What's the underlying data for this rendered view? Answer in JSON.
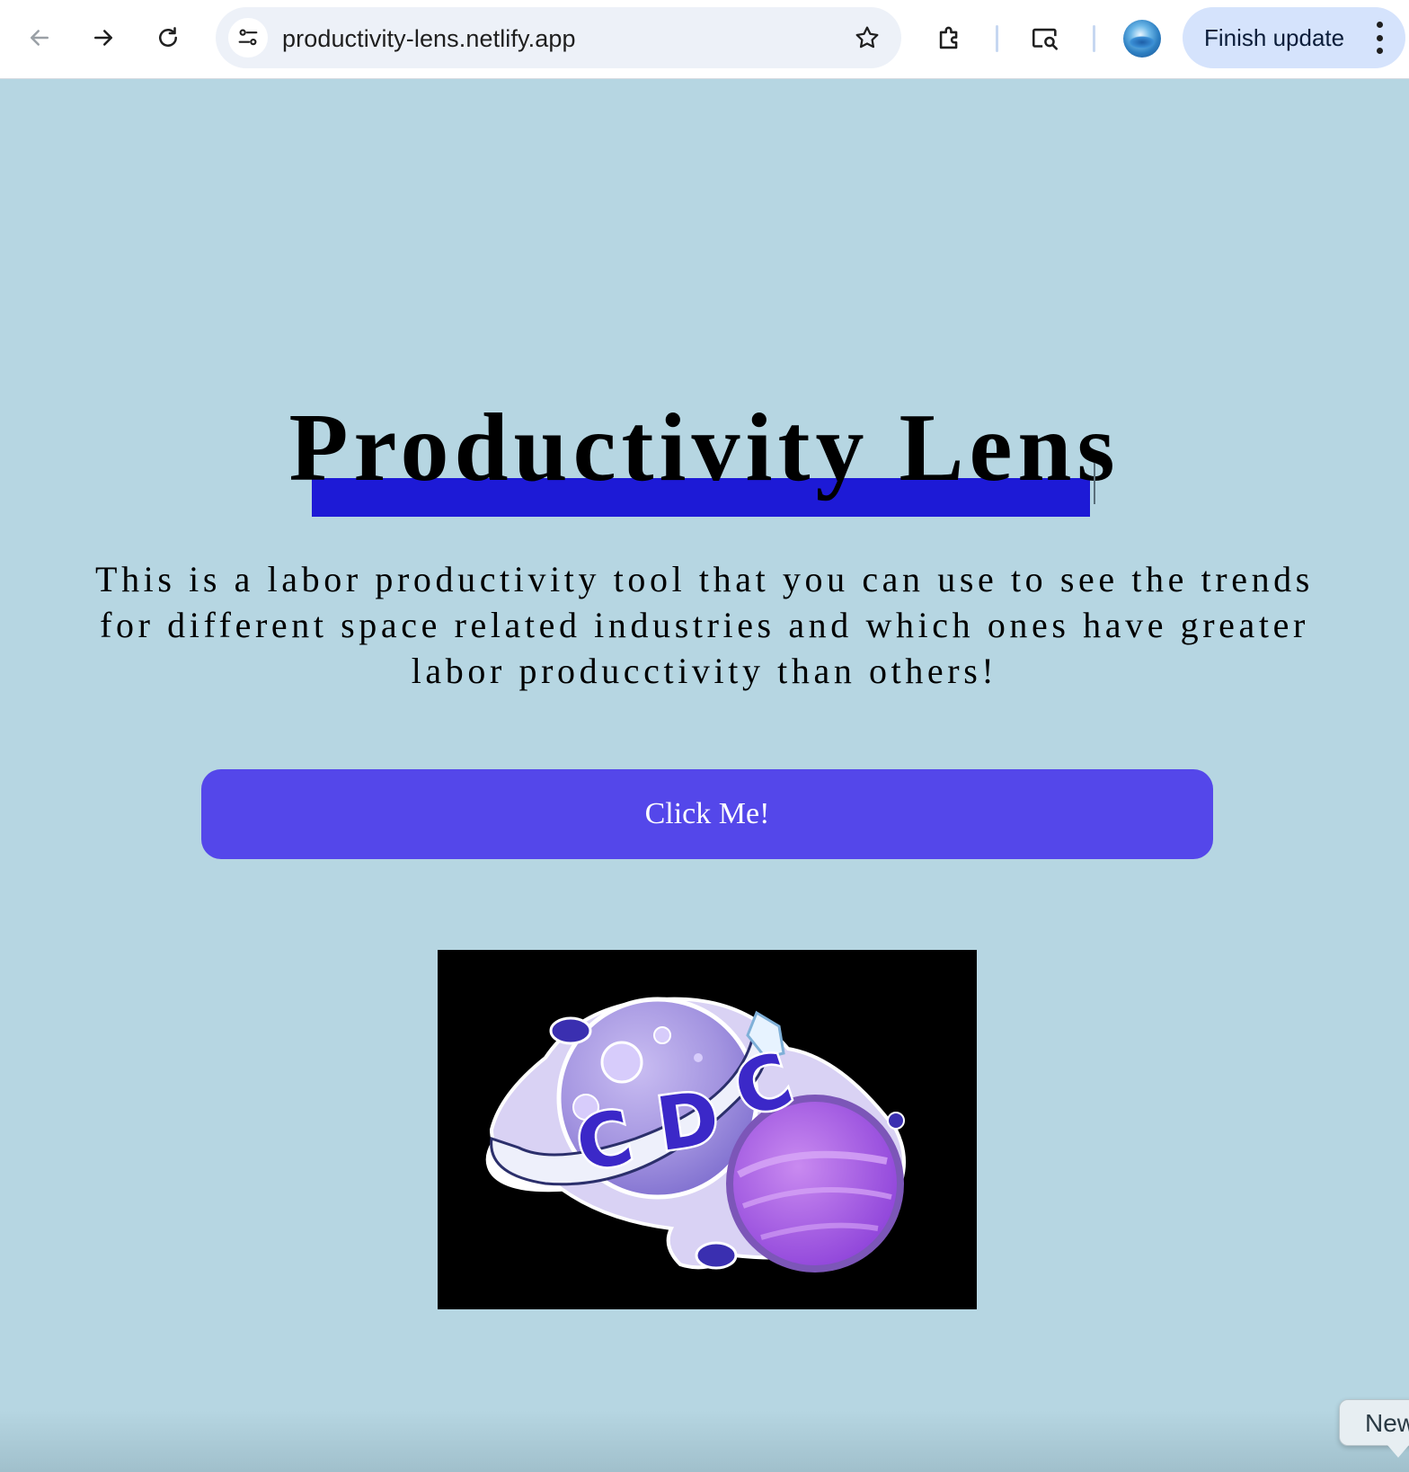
{
  "browser": {
    "url": "productivity-lens.netlify.app",
    "update_label": "Finish update",
    "icons": {
      "back": "arrow-left-icon",
      "forward": "arrow-right-icon",
      "reload": "reload-icon",
      "site_info": "tune-icon",
      "bookmark": "star-icon",
      "extensions": "puzzle-icon",
      "cast": "screen-search-icon",
      "menu": "kebab-icon"
    }
  },
  "page": {
    "title": "Productivity Lens",
    "description": "This is a labor productivity tool that you can use to see the trends for different space related industries and which ones have greater labor producctivity than others!",
    "cta_label": "Click Me!",
    "logo_text": "CDC",
    "new_tip": "New",
    "colors": {
      "background": "#b6d6e2",
      "highlight": "#1d1ad6",
      "button": "#5447ea",
      "logo_bg": "#000000"
    }
  }
}
